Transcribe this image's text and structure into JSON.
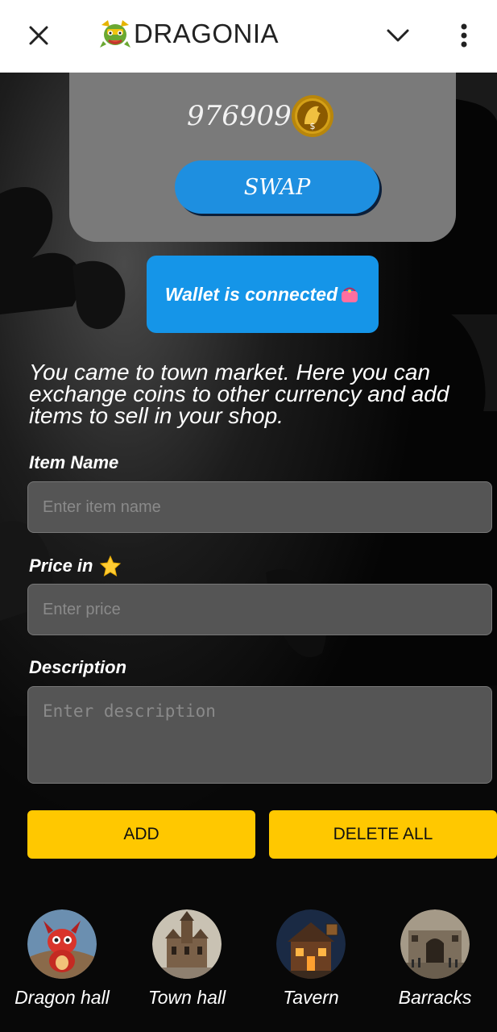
{
  "header": {
    "title": "DRAGONIA",
    "close_icon": "close-icon",
    "logo_icon": "dragon-logo-icon",
    "chevron_icon": "chevron-down-icon",
    "more_icon": "more-vert-icon"
  },
  "balance": {
    "amount": "976909",
    "coin_icon": "dragon-coin-icon",
    "swap_label": "SWAP"
  },
  "wallet": {
    "label": "Wallet is connected",
    "icon": "purse-icon"
  },
  "intro_text": "You came to town market. Here you can exchange coins to other currency and add items to sell in your shop.",
  "form": {
    "item_name_label": "Item Name",
    "item_name_placeholder": "Enter item name",
    "item_name_value": "",
    "price_label": "Price in",
    "price_icon": "star-icon",
    "price_placeholder": "Enter price",
    "price_value": "",
    "description_label": "Description",
    "description_placeholder": "Enter description",
    "description_value": "",
    "add_label": "ADD",
    "delete_all_label": "DELETE ALL"
  },
  "bottom_nav": [
    {
      "label": "Dragon hall",
      "icon": "dragon-hall-avatar"
    },
    {
      "label": "Town hall",
      "icon": "town-hall-avatar"
    },
    {
      "label": "Tavern",
      "icon": "tavern-avatar"
    },
    {
      "label": "Barracks",
      "icon": "barracks-avatar"
    }
  ],
  "colors": {
    "accent_blue": "#1e8fe0",
    "wallet_blue": "#1595e8",
    "button_yellow": "#ffc800",
    "card_grey": "#7a7a7a",
    "field_grey": "#555555"
  }
}
